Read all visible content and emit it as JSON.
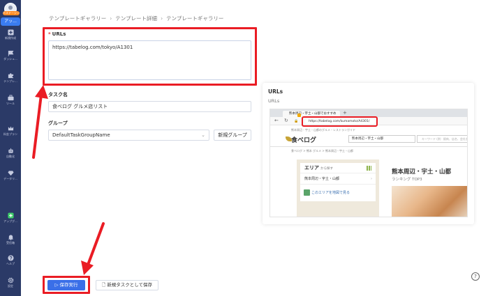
{
  "sidebar": {
    "badge": "ホステージン",
    "active_label": "アッ...",
    "items": [
      {
        "label": "新規作成",
        "icon": "plus-square-icon"
      },
      {
        "label": "ダッシュ...",
        "icon": "flag-icon"
      },
      {
        "label": "テンプレ...",
        "icon": "puzzle-icon"
      },
      {
        "label": "ツール",
        "icon": "toolbox-icon"
      },
      {
        "label": "料金プラン",
        "icon": "crown-icon"
      },
      {
        "label": "自動化",
        "icon": "robot-icon"
      },
      {
        "label": "データリ...",
        "icon": "diamond-icon"
      },
      {
        "label": "アップグ...",
        "icon": "upgrade-icon"
      },
      {
        "label": "受信箱",
        "icon": "bell-icon"
      },
      {
        "label": "ヘルプ",
        "icon": "help-icon"
      },
      {
        "label": "設定",
        "icon": "gear-icon"
      }
    ]
  },
  "breadcrumb": [
    "テンプレートギャラリー",
    "テンプレート詳細",
    "テンプレートギャラリー"
  ],
  "form": {
    "urls_label": "URLs",
    "urls_value": "https://tabelog.com/tokyo/A1301",
    "task_name_label": "タスク名",
    "task_name_value": "食べログ グルメ店リスト",
    "group_label": "グループ",
    "group_value": "DefaultTaskGroupName",
    "new_group_button": "新規グループ"
  },
  "actions": {
    "save_run": "保存実行",
    "save_new": "新規タスクとして保存"
  },
  "preview": {
    "title": "URLs",
    "subtitle": "URLs",
    "browser": {
      "tab_title": "熊本周辺・宇土・山都でおすすめ",
      "plus": "+",
      "url": "https://tabelog.com/kumamoto/A4301/",
      "breadcrumb": "熊本周辺・宇土・山都のグルメ・レストランガイド",
      "logo": "食べログ",
      "search_area": "熊本周辺・宇土・山都",
      "search_placeholder": "キーワード (例：焼肉、店名、会社名)",
      "breadcrumb2": "食べログ > 熊本 グルメ > 熊本周辺・宇土・山都",
      "area_heading": "エリア",
      "area_heading_sub": "から探す",
      "region_item": "熊本周辺・宇土・山都",
      "map_link": "このエリアを地図で見る",
      "main_title": "熊本周辺・宇土・山都",
      "ranking": "ランキング TOP3"
    }
  },
  "colors": {
    "sidebar_bg": "#2b3a67",
    "primary": "#3a6fe8",
    "highlight": "#ea1c24",
    "badge": "#ff8a1f"
  }
}
